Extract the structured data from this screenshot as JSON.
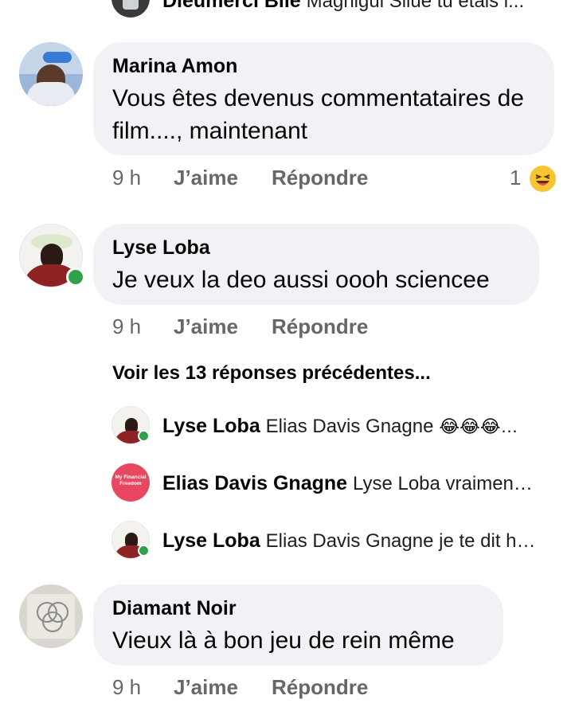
{
  "comments": [
    {
      "author": "Dieumerci Bile",
      "preview": "Magnigui Silue tu étais l..."
    },
    {
      "author": "Marina Amon",
      "text": "Vous êtes devenus commentataires de film...., maintenant",
      "time": "9 h",
      "like_label": "J’aime",
      "reply_label": "Répondre",
      "reaction_count": "1"
    },
    {
      "author": "Lyse Loba",
      "text": "Je veux la deo aussi oooh sciencee",
      "time": "9 h",
      "like_label": "J’aime",
      "reply_label": "Répondre"
    },
    {
      "author": "Diamant Noir",
      "text": "Vieux là à bon jeu de rein même",
      "time": "9 h",
      "like_label": "J’aime",
      "reply_label": "Répondre"
    }
  ],
  "view_previous": "Voir les 13 réponses précédentes...",
  "replies": [
    {
      "author": "Lyse Loba",
      "text": "Elias Davis Gnagne",
      "emojis": "😂😂😂…"
    },
    {
      "author": "Elias Davis Gnagne",
      "text": "Lyse Loba vraimen…",
      "avatar_text": "My Financial Freedom"
    },
    {
      "author": "Lyse Loba",
      "text": "Elias Davis Gnagne je te dit h…"
    }
  ],
  "colors": {
    "bubble": "#f0f2f5",
    "meta_text": "#65676b",
    "online": "#31a24c",
    "elias_avatar": "#e8485f"
  },
  "icons": {
    "reaction": "laughing-emoji",
    "reply_emoji": "tears-of-joy-emoji"
  }
}
